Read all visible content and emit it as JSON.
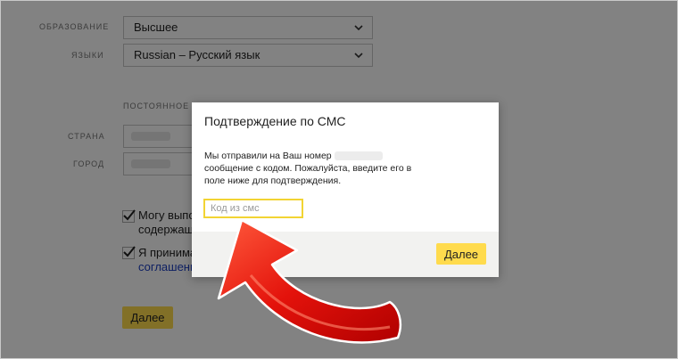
{
  "form": {
    "education": {
      "label": "ОБРАЗОВАНИЕ",
      "value": "Высшее"
    },
    "languages": {
      "label": "ЯЗЫКИ",
      "value": "Russian – Русский язык"
    },
    "section_title": "ПОСТОЯННОЕ МЕ",
    "country": {
      "label": "СТРАНА"
    },
    "city": {
      "label": "ГОРОД"
    },
    "checkbox1_line1": "Могу выпол",
    "checkbox1_line2": "содержащ",
    "checkbox2_line1": "Я принимаю",
    "checkbox2_link": "соглашения",
    "submit_label": "Далее"
  },
  "modal": {
    "title": "Подтверждение по СМС",
    "text_part1": "Мы отправили на Ваш номер",
    "text_part2": "сообщение с кодом. Пожалуйста, введите его в поле ниже для подтверждения.",
    "input_placeholder": "Код из смс",
    "button_label": "Далее"
  },
  "colors": {
    "accent_yellow": "#ffdb4d",
    "input_focus_border": "#f2d433",
    "arrow_red": "#e3120b",
    "link_blue": "#1a3dc1"
  }
}
